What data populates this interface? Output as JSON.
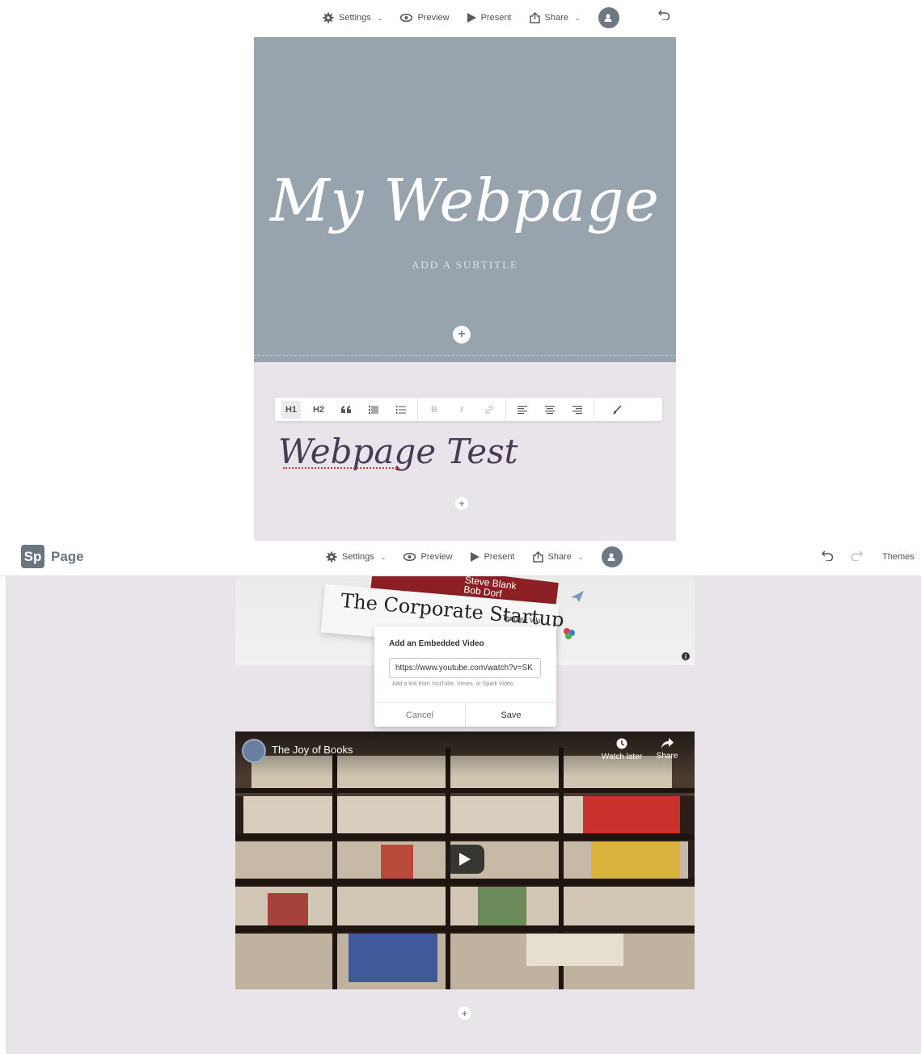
{
  "top_panel": {
    "toolbar": {
      "settings": "Settings",
      "preview": "Preview",
      "present": "Present",
      "share": "Share"
    },
    "hero": {
      "title": "My Webpage",
      "subtitle": "ADD A SUBTITLE",
      "add": "+"
    },
    "format_bar": {
      "h1": "H1",
      "h2": "H2",
      "quote": "66",
      "bold": "B",
      "italic": "I"
    },
    "text_block": {
      "heading": "Webpage Test",
      "add": "+"
    }
  },
  "app": {
    "logo_mark": "Sp",
    "logo_text": "Page",
    "toolbar": {
      "settings": "Settings",
      "preview": "Preview",
      "present": "Present",
      "share": "Share"
    },
    "themes": "Themes"
  },
  "image_block": {
    "book_title": "The Corporate Startup",
    "author_line1": "Steve Blank",
    "author_line2": "Bob Dorf",
    "author3": "Tendayi Viki",
    "info": "i"
  },
  "embed_dialog": {
    "title": "Add an Embedded Video",
    "url_value": "https://www.youtube.com/watch?v=SK",
    "help": "Add a link from YouTube, Vimeo, or Spark Video.",
    "cancel": "Cancel",
    "save": "Save"
  },
  "video": {
    "title": "The Joy of Books",
    "watch_later": "Watch later",
    "share": "Share"
  },
  "canvas_add": "+",
  "colors": {
    "hero_bg": "#97a4ae",
    "section_bg": "#e8e4ea",
    "accent": "#6b7580"
  }
}
